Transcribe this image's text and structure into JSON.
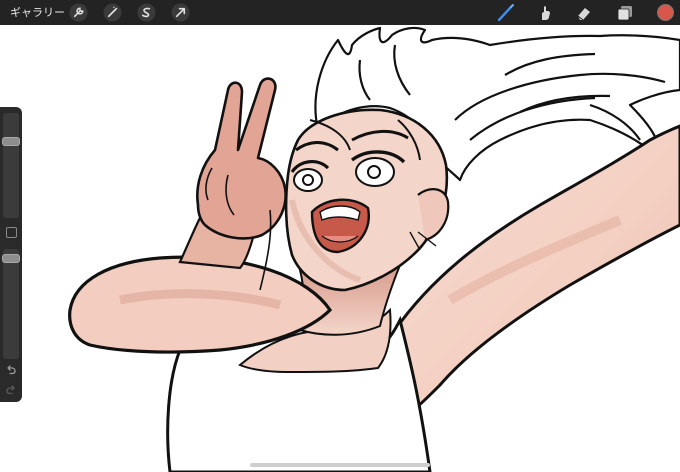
{
  "toolbar": {
    "gallery_label": "ギャラリー",
    "left_tools": [
      {
        "icon": "wrench-icon"
      },
      {
        "icon": "adjustments-icon"
      },
      {
        "icon": "selection-icon"
      },
      {
        "icon": "transform-arrow-icon"
      }
    ],
    "right_tools": [
      {
        "icon": "brush-icon",
        "active": true
      },
      {
        "icon": "smudge-icon"
      },
      {
        "icon": "eraser-icon"
      },
      {
        "icon": "layers-icon"
      }
    ],
    "current_color": "#d9564a",
    "active_tool_color": "#3d8ff0"
  },
  "sidebar": {
    "brush_size_level": 0.75,
    "opacity_level": 0.05
  },
  "colors": {
    "toolbar_bg": "#232323",
    "skin": "#f5d3c6",
    "skin_shadow": "#d9a394",
    "line": "#111111"
  }
}
